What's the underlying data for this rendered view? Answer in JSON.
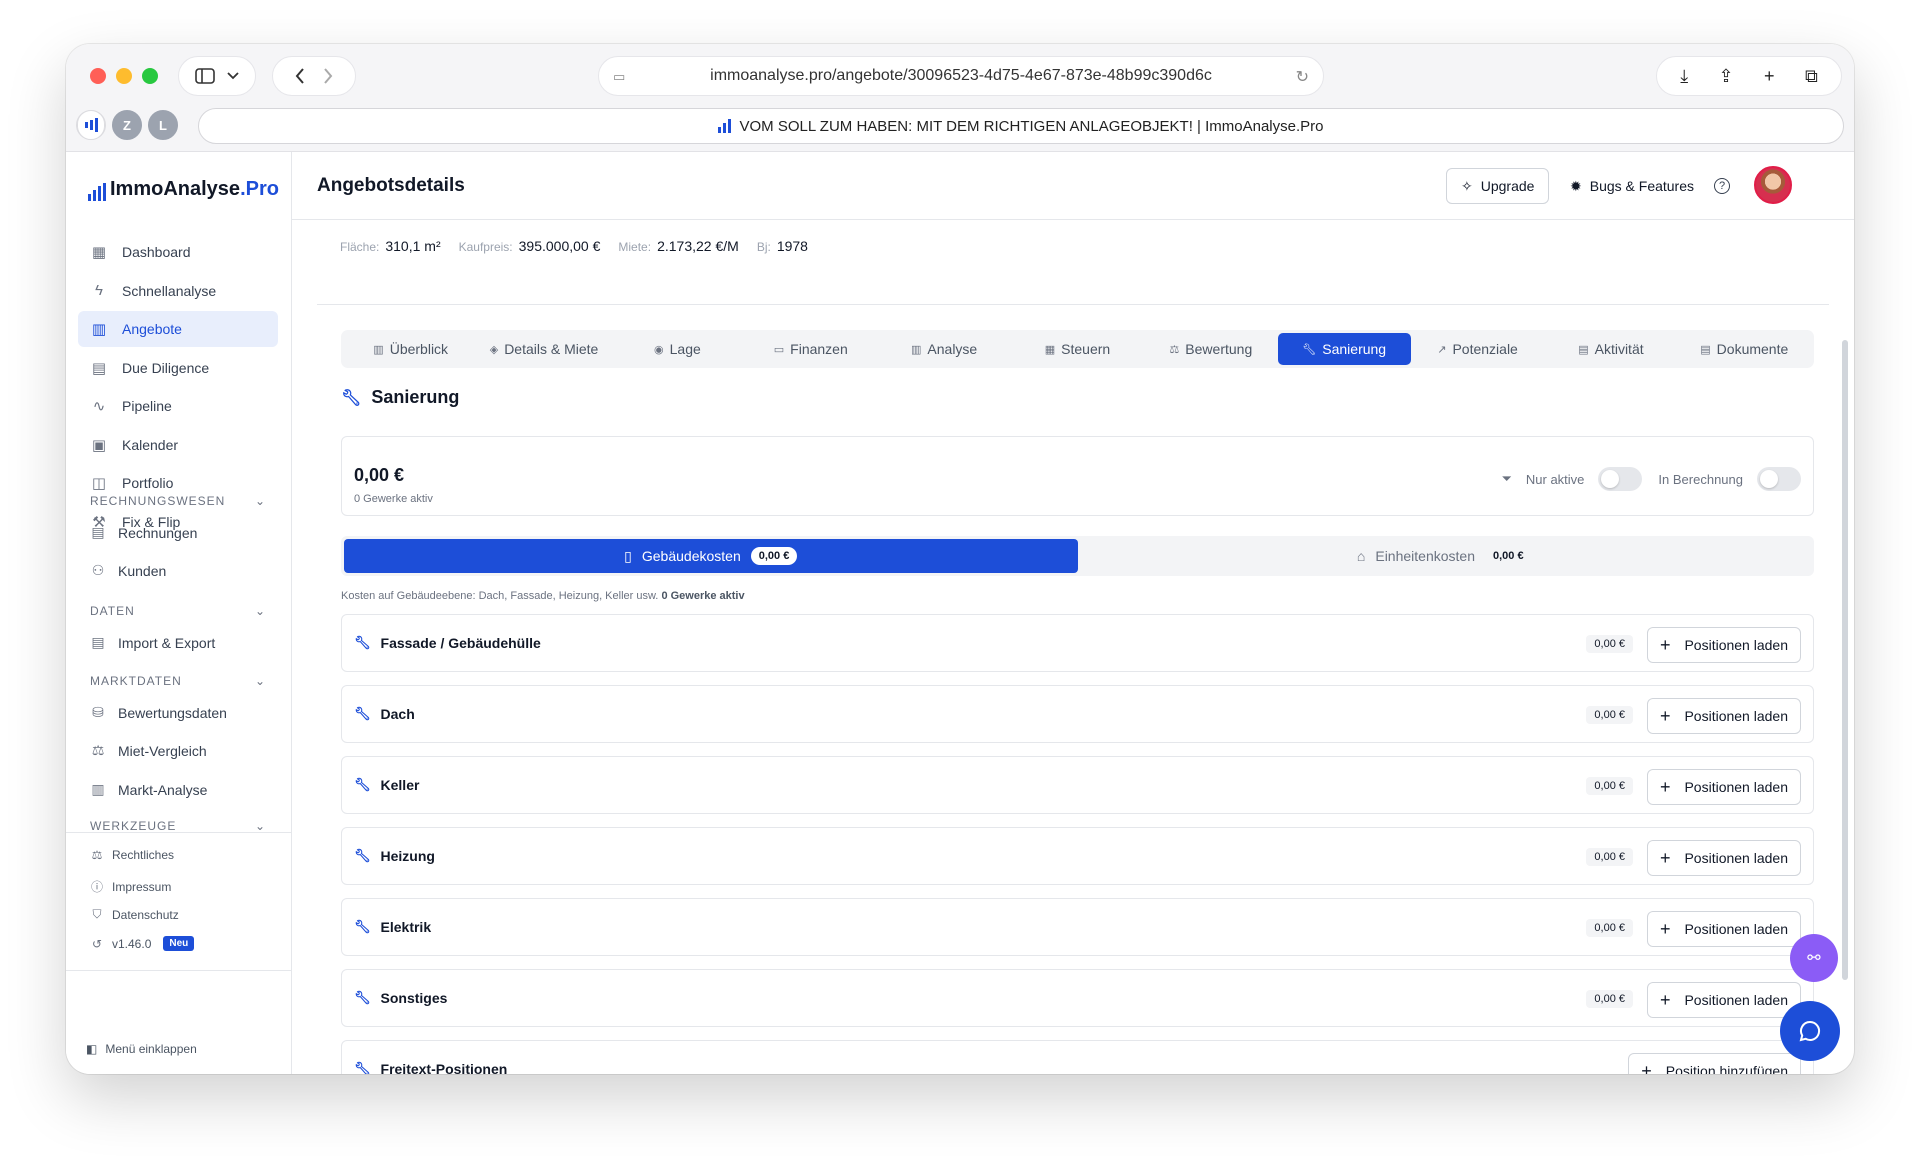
{
  "browser": {
    "url": "immoanalyse.pro/angebote/30096523-4d75-4e67-873e-48b99c390d6c",
    "tab_title": "VOM SOLL ZUM HABEN: MIT DEM RICHTIGEN ANLAGEOBJEKT! | ImmoAnalyse.Pro",
    "fav_z": "Z",
    "fav_l": "L"
  },
  "brand": {
    "name": "ImmoAnalyse",
    "suffix": ".Pro"
  },
  "sidebar": {
    "items": [
      {
        "label": "Dashboard",
        "icon": "grid-icon"
      },
      {
        "label": "Schnellanalyse",
        "icon": "bolt-icon"
      },
      {
        "label": "Angebote",
        "icon": "building-icon"
      },
      {
        "label": "Due Diligence",
        "icon": "clipboard-icon"
      },
      {
        "label": "Pipeline",
        "icon": "activity-icon"
      },
      {
        "label": "Kalender",
        "icon": "calendar-icon"
      },
      {
        "label": "Portfolio",
        "icon": "briefcase-icon"
      },
      {
        "label": "Fix & Flip",
        "icon": "hammer-icon"
      }
    ],
    "sections": [
      {
        "title": "RECHNUNGSWESEN",
        "items": [
          "Rechnungen",
          "Kunden"
        ]
      },
      {
        "title": "DATEN",
        "items": [
          "Import & Export"
        ]
      },
      {
        "title": "MARKTDATEN",
        "items": [
          "Bewertungsdaten",
          "Miet-Vergleich",
          "Markt-Analyse"
        ]
      },
      {
        "title": "WERKZEUGE",
        "items": []
      }
    ],
    "footer": [
      "Rechtliches",
      "Impressum",
      "Datenschutz"
    ],
    "version": "v1.46.0",
    "version_badge": "Neu",
    "collapse_label": "Menü einklappen"
  },
  "header": {
    "title": "Angebotsdetails",
    "upgrade_label": "Upgrade",
    "bugs_label": "Bugs & Features",
    "help": "?"
  },
  "meta": {
    "flaeche_key": "Fläche:",
    "flaeche_val": "310,1 m²",
    "kaufpreis_key": "Kaufpreis:",
    "kaufpreis_val": "395.000,00 €",
    "miete_key": "Miete:",
    "miete_val": "2.173,22 €/M",
    "bj_key": "Bj:",
    "bj_val": "1978"
  },
  "tabs": [
    "Überblick",
    "Details & Miete",
    "Lage",
    "Finanzen",
    "Analyse",
    "Steuern",
    "Bewertung",
    "Sanierung",
    "Potenziale",
    "Aktivität",
    "Dokumente"
  ],
  "active_tab": "Sanierung",
  "sanierung": {
    "title": "Sanierung",
    "total": "0,00 €",
    "active_count": "0 Gewerke aktiv",
    "filter_active": "Nur aktive",
    "filter_calc": "In Berechnung",
    "seg_building": "Gebäudekosten",
    "seg_building_val": "0,00 €",
    "seg_units": "Einheitenkosten",
    "seg_units_val": "0,00 €",
    "note": "Kosten auf Gebäudeebene: Dach, Fassade, Heizung, Keller usw.",
    "note_count": "0 Gewerke aktiv",
    "rows": [
      {
        "label": "Fassade / Gebäudehülle",
        "amount": "0,00 €",
        "button": "Positionen laden"
      },
      {
        "label": "Dach",
        "amount": "0,00 €",
        "button": "Positionen laden"
      },
      {
        "label": "Keller",
        "amount": "0,00 €",
        "button": "Positionen laden"
      },
      {
        "label": "Heizung",
        "amount": "0,00 €",
        "button": "Positionen laden"
      },
      {
        "label": "Elektrik",
        "amount": "0,00 €",
        "button": "Positionen laden"
      },
      {
        "label": "Sonstiges",
        "amount": "0,00 €",
        "button": "Positionen laden"
      }
    ],
    "freitext_label": "Freitext-Positionen",
    "freitext_button": "Position hinzufügen"
  },
  "colors": {
    "accent": "#1d4ed8",
    "fab_share": "#8b5cf6"
  }
}
